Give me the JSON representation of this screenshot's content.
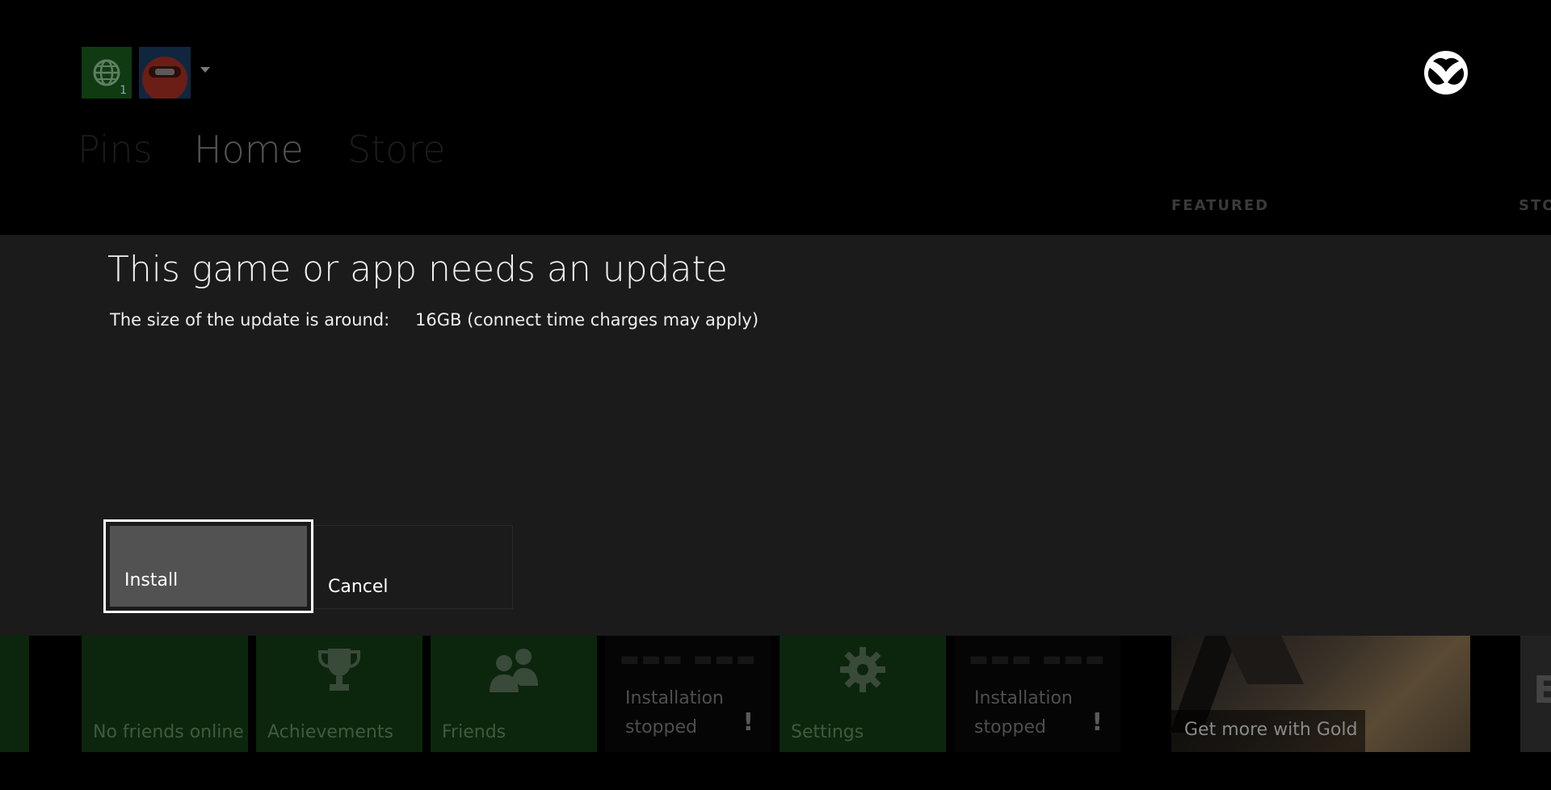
{
  "header": {
    "avatar_badge": "1",
    "tabs": [
      "Pins",
      "Home",
      "Store"
    ],
    "sections": [
      "FEATURED",
      "STO"
    ]
  },
  "dialog": {
    "title": "This game or app needs an update",
    "size_label": "The size of the update is around:",
    "size_value": "16GB (connect time charges may apply)",
    "install_label": "Install",
    "cancel_label": "Cancel"
  },
  "tiles": {
    "friends_online": "No friends online",
    "achievements": "Achievements",
    "friends": "Friends",
    "install_stopped_1": [
      "Installation",
      "stopped"
    ],
    "settings": "Settings",
    "install_stopped_2": [
      "Installation",
      "stopped"
    ],
    "gold": "Get more with Gold",
    "partial": "E"
  },
  "icons": {
    "xbox": "xbox-logo-icon",
    "globe": "globe-icon",
    "trophy": "trophy-icon",
    "people": "people-icon",
    "gear": "gear-icon",
    "warning": "exclamation-icon"
  },
  "colors": {
    "tile_green": "#0c260d",
    "dialog_bg": "#1b1b1b",
    "button_focus": "#525252"
  }
}
